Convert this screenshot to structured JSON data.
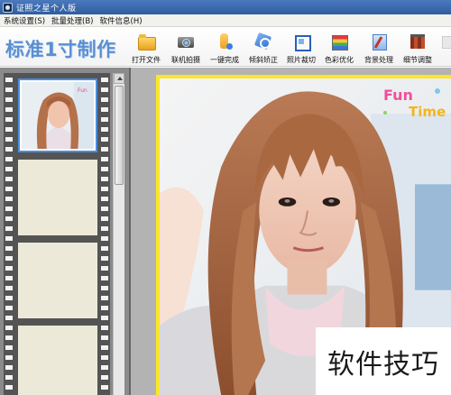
{
  "window": {
    "title": "证照之星个人版"
  },
  "menu": [
    {
      "label": "系统设置(S)"
    },
    {
      "label": "批量处理(B)"
    },
    {
      "label": "软件信息(H)"
    }
  ],
  "toolbar": {
    "brand": "标准1寸制作",
    "tools": [
      {
        "label": "打开文件",
        "icon": "folder-icon"
      },
      {
        "label": "联机拍摄",
        "icon": "camera-icon"
      },
      {
        "label": "一键完成",
        "icon": "hand-icon"
      },
      {
        "label": "倾斜矫正",
        "icon": "tilt-correct-icon"
      },
      {
        "label": "照片裁切",
        "icon": "crop-icon"
      },
      {
        "label": "色彩优化",
        "icon": "color-bars-icon"
      },
      {
        "label": "背景处理",
        "icon": "background-brush-icon"
      },
      {
        "label": "细节调整",
        "icon": "detail-adjust-icon"
      },
      {
        "label": "",
        "icon": "more-icon"
      }
    ]
  },
  "sticker": {
    "line1": "Fun",
    "line2": "Time"
  },
  "watermark": {
    "text": "软件技巧"
  },
  "colors": {
    "title_bar": "#3b6db0",
    "brand": "#5a8fd2",
    "frame_border": "#fbe62b",
    "selected_thumb": "#4a8fe0"
  }
}
